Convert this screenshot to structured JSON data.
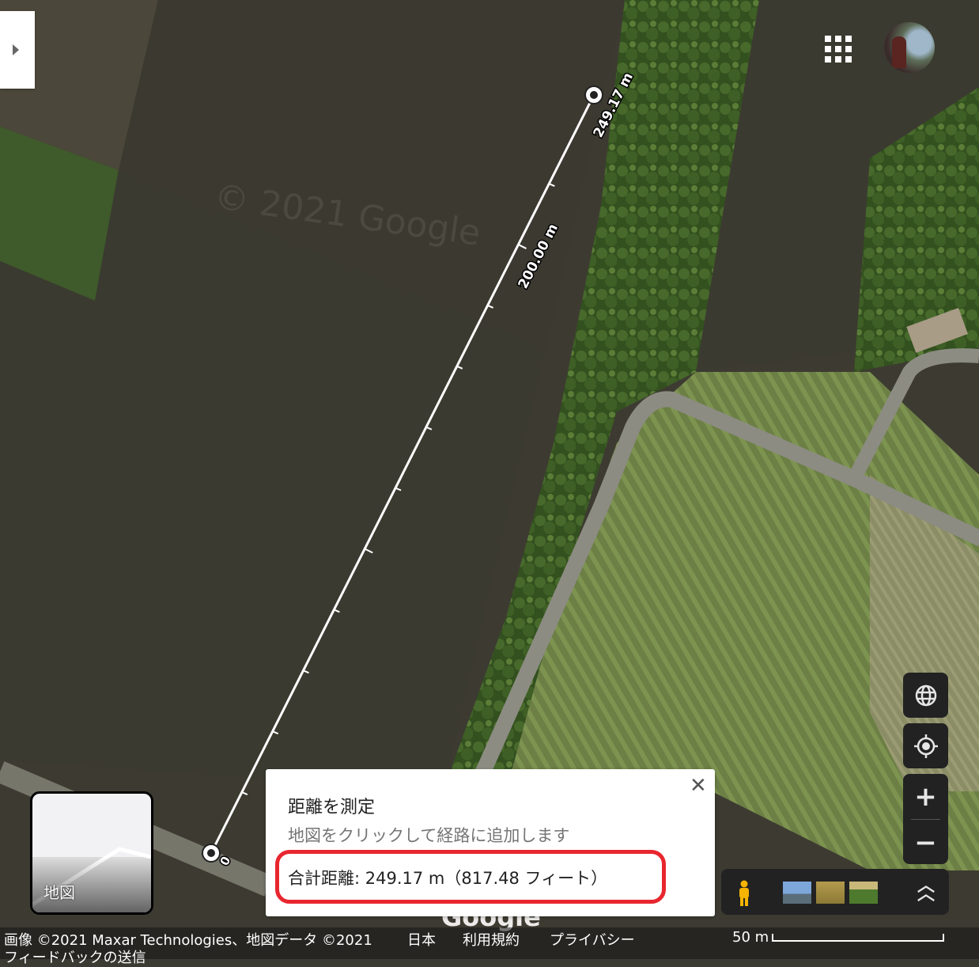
{
  "map": {
    "watermark": "© 2021 Google",
    "brand": "Google",
    "measure_line": {
      "segment_label_end": "249.17 m",
      "segment_label_mid": "200.00 m"
    }
  },
  "minimap": {
    "label": "地図"
  },
  "measure_card": {
    "title": "距離を測定",
    "instruction": "地図をクリックして経路に追加します",
    "total": "合計距離: 249.17 m（817.48 フィート）",
    "close_icon": "close-icon"
  },
  "footer": {
    "attribution": "画像 ©2021 Maxar Technologies、地図データ ©2021",
    "region": "日本",
    "terms": "利用規約",
    "privacy": "プライバシー",
    "scale": "50 m",
    "feedback": "フィードバックの送信"
  },
  "controls": {
    "globe_icon": "globe-icon",
    "location_icon": "my-location-icon",
    "zoom_in": "+",
    "zoom_out": "−",
    "expand_icon": "double-chevron-up-icon"
  },
  "colors": {
    "highlight": "#e8262e",
    "control_bg": "#222222"
  }
}
